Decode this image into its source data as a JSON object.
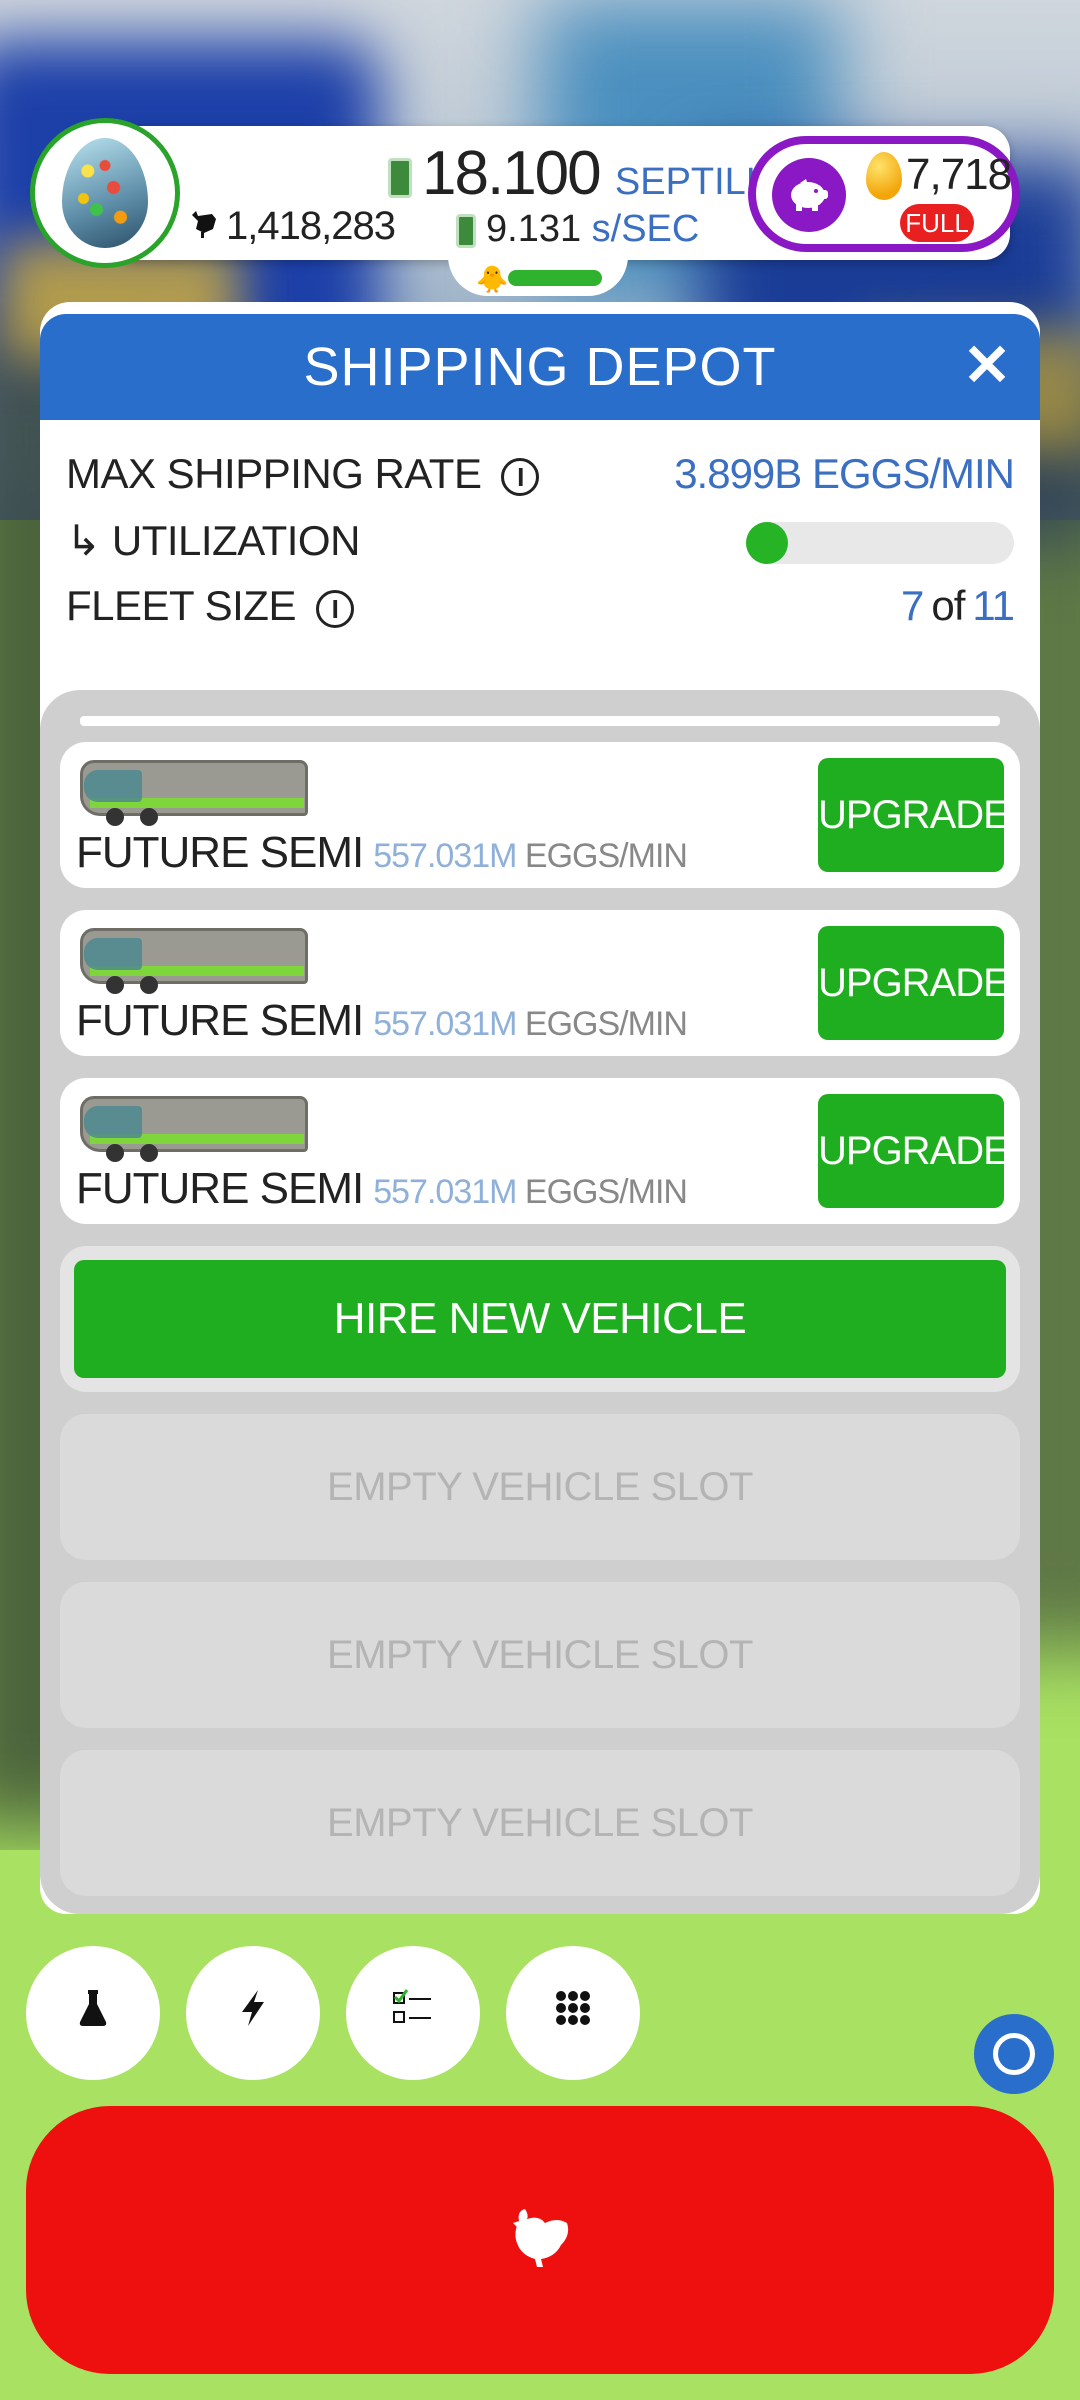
{
  "hud": {
    "chicken_count": "1,418,283",
    "money_amount": "18.100",
    "money_unit": "SEPTILLION",
    "earn_rate": "9.131",
    "earn_rate_unit": "s/SEC",
    "golden_eggs": "7,718",
    "piggy_status": "FULL"
  },
  "panel": {
    "title": "SHIPPING DEPOT",
    "close_glyph": "✕",
    "max_rate_label": "MAX SHIPPING RATE",
    "max_rate_value": "3.899B EGGS/MIN",
    "utilization_label": "↳ UTILIZATION",
    "utilization_fraction": 0.05,
    "fleet_label": "FLEET SIZE",
    "fleet_current": "7",
    "fleet_of": "of",
    "fleet_max": "11",
    "info_glyph": "i"
  },
  "vehicles": [
    {
      "name": "FUTURE SEMI",
      "rate": "557.031M",
      "unit": "EGGS/MIN",
      "action": "UPGRADE"
    },
    {
      "name": "FUTURE SEMI",
      "rate": "557.031M",
      "unit": "EGGS/MIN",
      "action": "UPGRADE"
    },
    {
      "name": "FUTURE SEMI",
      "rate": "557.031M",
      "unit": "EGGS/MIN",
      "action": "UPGRADE"
    }
  ],
  "hire_label": "HIRE NEW VEHICLE",
  "empty_slots": [
    "EMPTY VEHICLE SLOT",
    "EMPTY VEHICLE SLOT",
    "EMPTY VEHICLE SLOT"
  ],
  "tools": [
    {
      "icon": "flask-icon",
      "glyph": "⚗"
    },
    {
      "icon": "lightning-icon",
      "glyph": "⚡"
    },
    {
      "icon": "checklist-icon",
      "glyph": "☑"
    },
    {
      "icon": "grid-menu-icon",
      "glyph": "⠿"
    }
  ],
  "colors": {
    "accent_blue": "#2a6ecb",
    "upgrade_green": "#1fae1f",
    "hatch_red": "#ee0f0f",
    "golden_purple": "#8a18c4",
    "grass": "#a9e262"
  }
}
